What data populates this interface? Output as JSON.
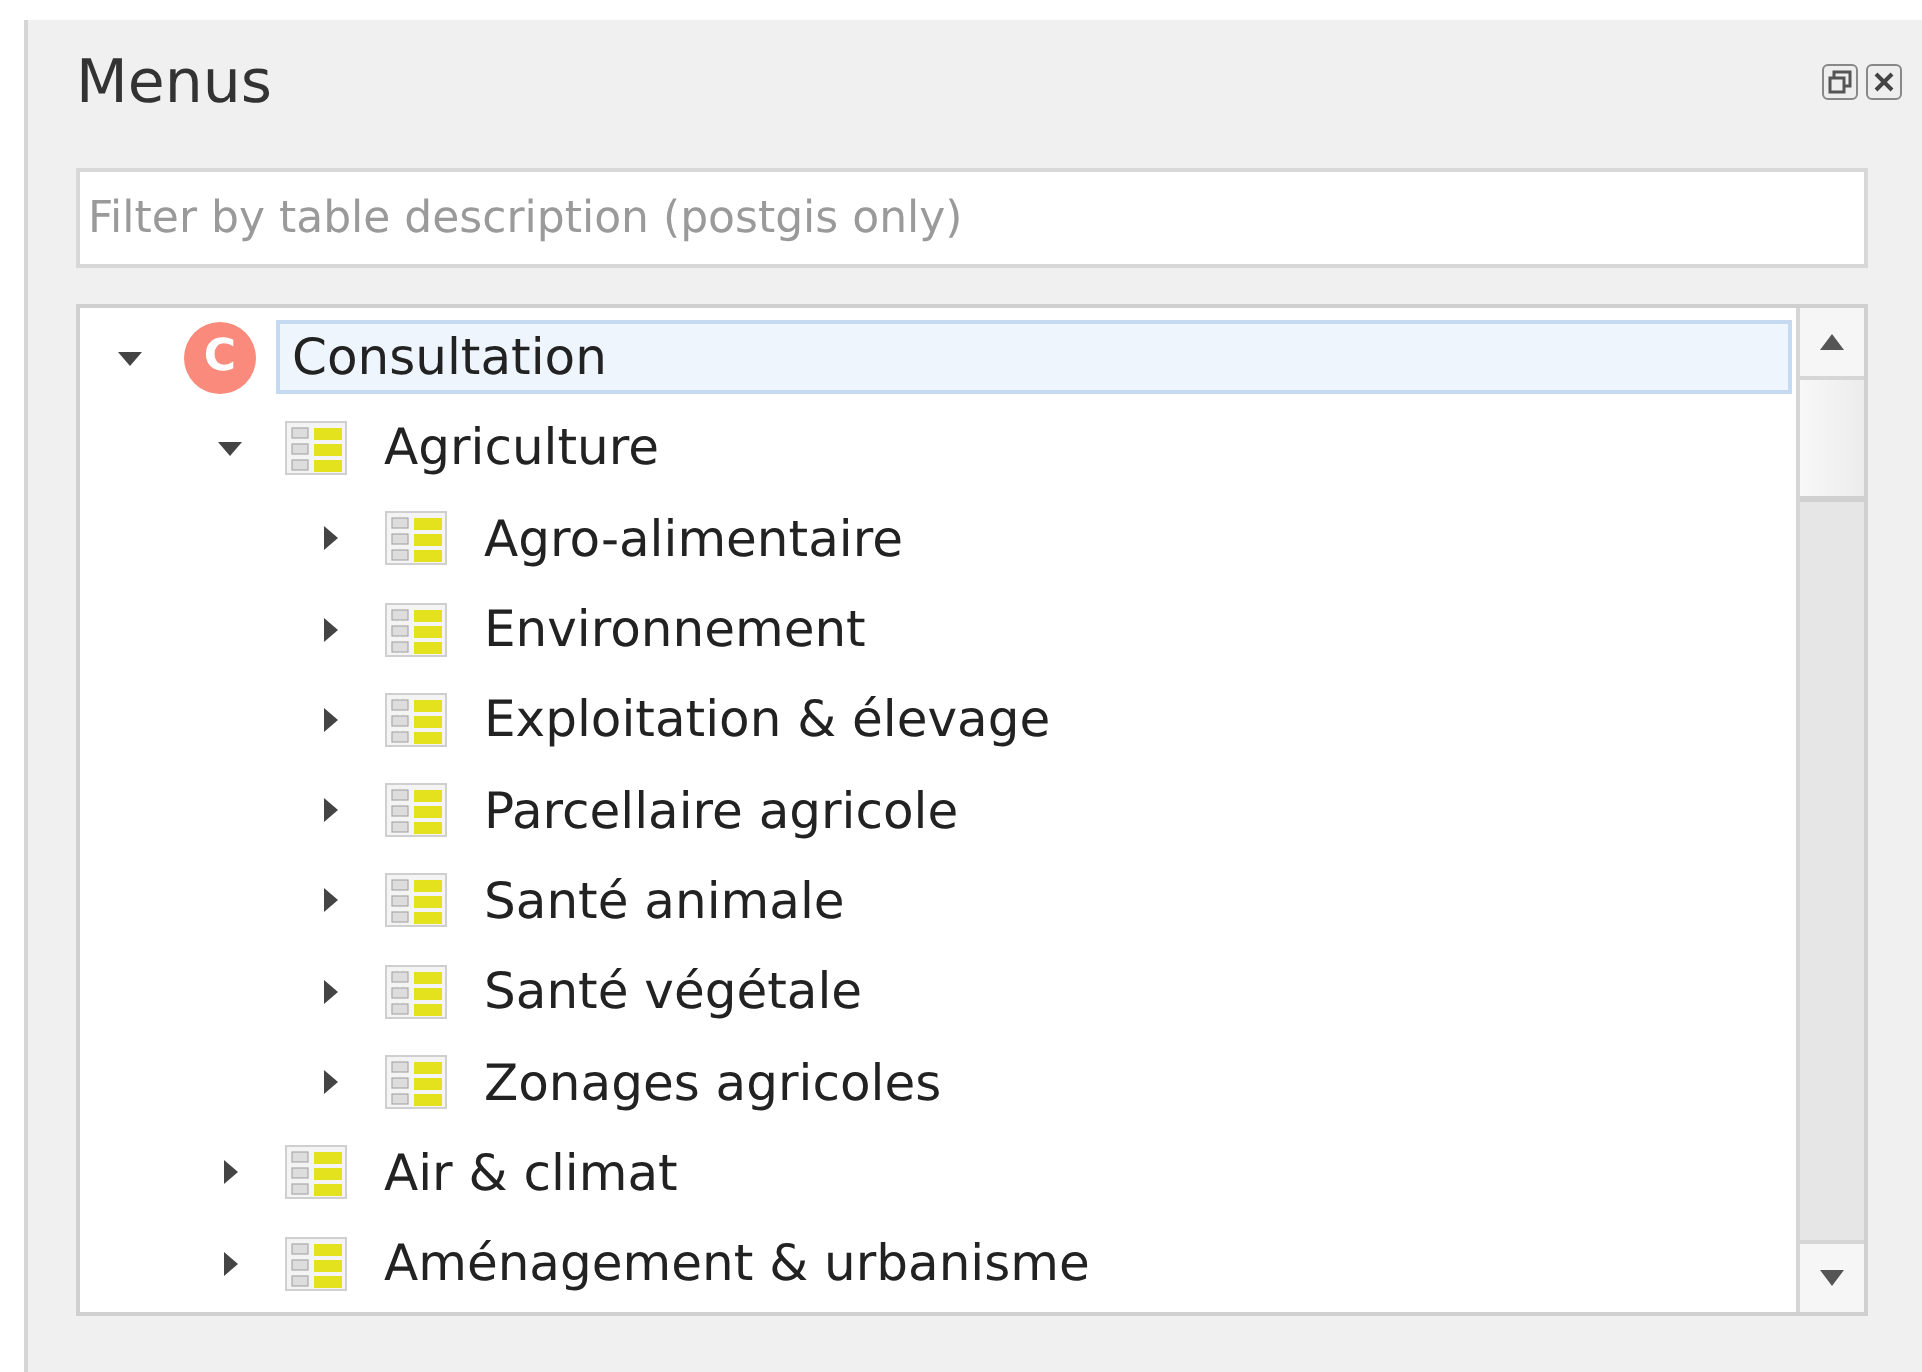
{
  "panel": {
    "title": "Menus"
  },
  "filter": {
    "placeholder": "Filter by table description (postgis only)"
  },
  "tree": [
    {
      "label": "Consultation",
      "kind": "root",
      "badge": "C",
      "expanded": true,
      "selected": true,
      "children": [
        {
          "label": "Agriculture",
          "kind": "group",
          "expanded": true,
          "selected": false,
          "children": [
            {
              "label": "Agro-alimentaire",
              "kind": "group",
              "expanded": false,
              "selected": false
            },
            {
              "label": "Environnement",
              "kind": "group",
              "expanded": false,
              "selected": false
            },
            {
              "label": "Exploitation & élevage",
              "kind": "group",
              "expanded": false,
              "selected": false
            },
            {
              "label": "Parcellaire agricole",
              "kind": "group",
              "expanded": false,
              "selected": false
            },
            {
              "label": "Santé animale",
              "kind": "group",
              "expanded": false,
              "selected": false
            },
            {
              "label": "Santé végétale",
              "kind": "group",
              "expanded": false,
              "selected": false
            },
            {
              "label": "Zonages agricoles",
              "kind": "group",
              "expanded": false,
              "selected": false
            }
          ]
        },
        {
          "label": "Air & climat",
          "kind": "group",
          "expanded": false,
          "selected": false
        },
        {
          "label": "Aménagement & urbanisme",
          "kind": "group",
          "expanded": false,
          "selected": false
        }
      ]
    }
  ]
}
